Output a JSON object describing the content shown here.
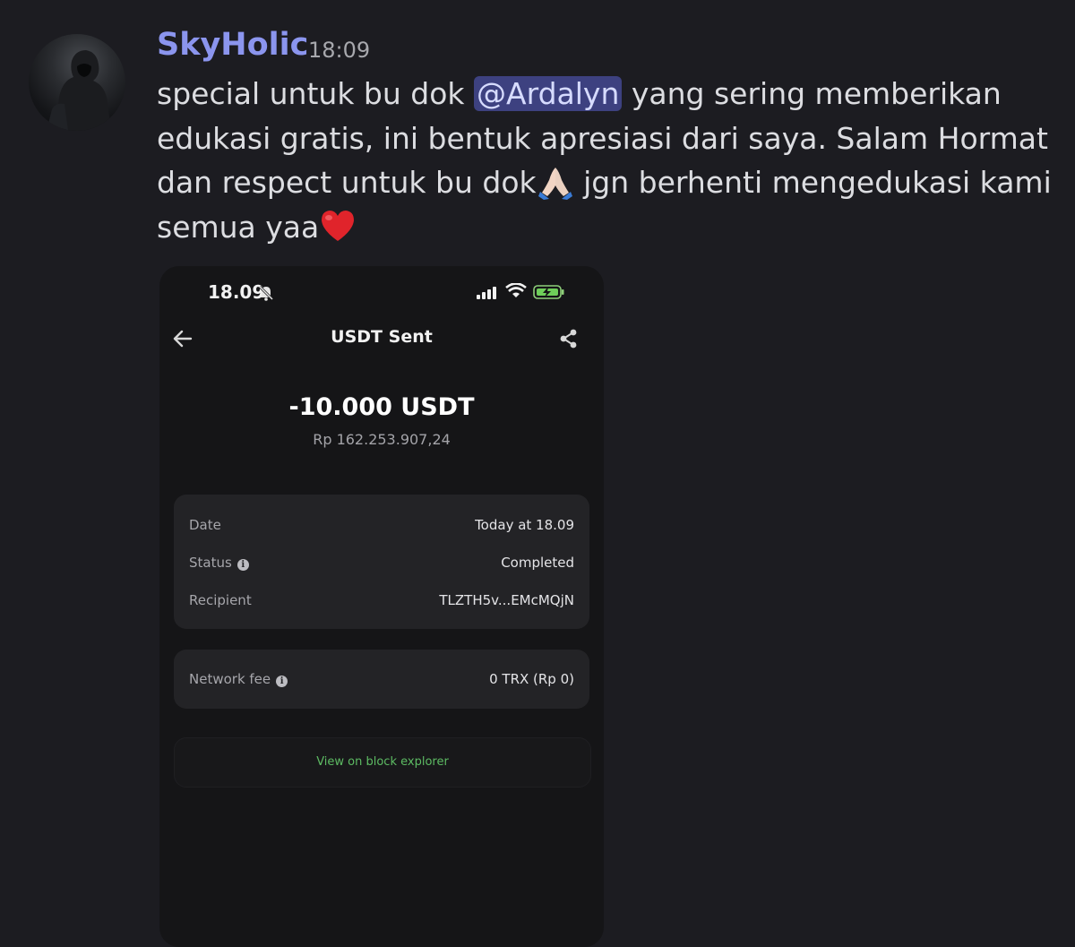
{
  "message": {
    "username": "SkyHolic",
    "timestamp": "18:09",
    "text_before_mention": "special untuk bu dok ",
    "mention": "@Ardalyn",
    "text_after_mention": " yang sering memberikan edukasi gratis, ini bentuk apresiasi dari saya. Salam Hormat dan respect untuk bu dok",
    "text_after_pray": " jgn berhenti mengedukasi kami semua yaa",
    "emojis": [
      "folded-hands",
      "red-heart"
    ],
    "colors": {
      "background": "#1c1c21",
      "username": "#8b95ee",
      "mention_bg": "#3d4180",
      "text": "#dcdde1"
    }
  },
  "attachment": {
    "status_bar": {
      "time": "18.09",
      "icons": [
        "bell-slash-icon",
        "signal-icon",
        "wifi-icon",
        "battery-charging-icon"
      ]
    },
    "header": {
      "title": "USDT Sent",
      "back_icon": "arrow-left-icon",
      "share_icon": "share-icon"
    },
    "amount": "-10.000 USDT",
    "fiat_value": "Rp 162.253.907,24",
    "details": [
      {
        "label": "Date",
        "value": "Today at 18.09",
        "info": false
      },
      {
        "label": "Status",
        "value": "Completed",
        "info": true
      },
      {
        "label": "Recipient",
        "value": "TLZTH5v...EMcMQjN",
        "info": false
      }
    ],
    "fee": {
      "label": "Network fee",
      "value": "0 TRX (Rp 0)",
      "info": true
    },
    "explorer_link": "View on block explorer",
    "colors": {
      "link": "#5dbb63",
      "card": "#232326"
    }
  }
}
